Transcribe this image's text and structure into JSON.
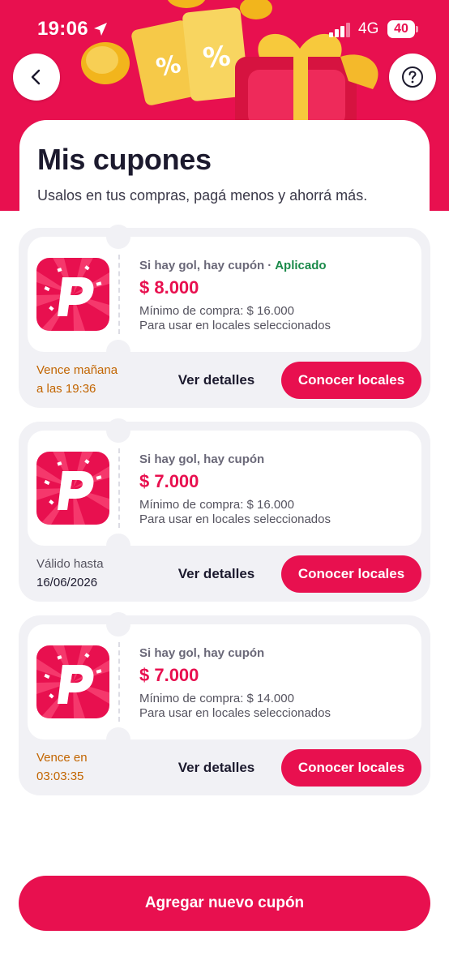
{
  "status_bar": {
    "time": "19:06",
    "network": "4G",
    "battery": "40"
  },
  "header": {
    "title": "Mis cupones",
    "subtitle": "Usalos en tus compras, pagá menos y ahorrá más."
  },
  "colors": {
    "brand": "#e8104f",
    "applied": "#1b8a4a",
    "expiring": "#c26500"
  },
  "coupons": [
    {
      "title": "Si hay gol, hay cupón",
      "status": "Aplicado",
      "amount": "$ 8.000",
      "min_purchase": "Mínimo de compra: $ 16.000",
      "usage": "Para usar en locales seleccionados",
      "expiry_label": "Vence mañana",
      "expiry_value": "a las 19:36",
      "details_label": "Ver detalles",
      "stores_label": "Conocer locales"
    },
    {
      "title": "Si hay gol, hay cupón",
      "amount": "$ 7.000",
      "min_purchase": "Mínimo de compra: $ 16.000",
      "usage": "Para usar en locales seleccionados",
      "expiry_label": "Válido hasta",
      "expiry_value": "16/06/2026",
      "details_label": "Ver detalles",
      "stores_label": "Conocer locales"
    },
    {
      "title": "Si hay gol, hay cupón",
      "amount": "$ 7.000",
      "min_purchase": "Mínimo de compra: $ 14.000",
      "usage": "Para usar en locales seleccionados",
      "expiry_label": "Vence en",
      "expiry_value": "03:03:35",
      "details_label": "Ver detalles",
      "stores_label": "Conocer locales"
    }
  ],
  "footer": {
    "add_label": "Agregar nuevo cupón"
  },
  "icons": [
    "back-arrow-icon",
    "help-icon",
    "location-arrow-icon",
    "signal-icon",
    "battery-icon",
    "pedidosya-logo-icon"
  ]
}
